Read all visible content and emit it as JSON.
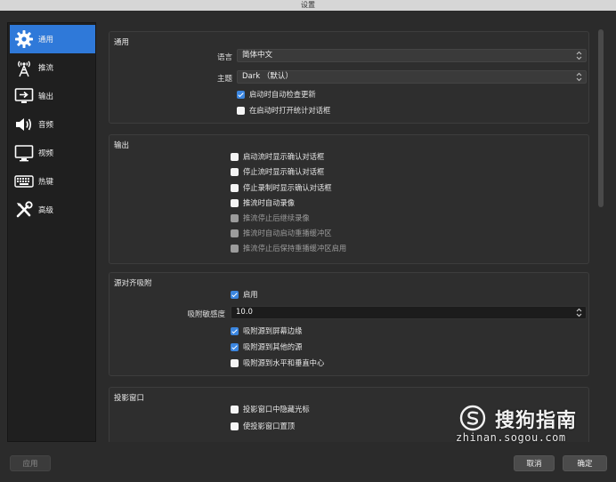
{
  "window": {
    "title": "设置"
  },
  "sidebar": {
    "items": [
      {
        "label": "通用",
        "icon": "gear-icon",
        "active": true
      },
      {
        "label": "推流",
        "icon": "broadcast-tower-icon",
        "active": false
      },
      {
        "label": "输出",
        "icon": "output-monitor-icon",
        "active": false
      },
      {
        "label": "音频",
        "icon": "speaker-icon",
        "active": false
      },
      {
        "label": "视频",
        "icon": "monitor-icon",
        "active": false
      },
      {
        "label": "热键",
        "icon": "keyboard-icon",
        "active": false
      },
      {
        "label": "高级",
        "icon": "tools-icon",
        "active": false
      }
    ]
  },
  "general": {
    "title": "通用",
    "language_label": "语言",
    "language_value": "简体中文",
    "theme_label": "主题",
    "theme_value": "Dark （默认）",
    "checkboxes": [
      {
        "label": "启动时自动检查更新",
        "checked": true,
        "disabled": false
      },
      {
        "label": "在启动时打开统计对话框",
        "checked": false,
        "disabled": false
      }
    ]
  },
  "output": {
    "title": "输出",
    "checkboxes": [
      {
        "label": "启动流时显示确认对话框",
        "checked": false,
        "disabled": false
      },
      {
        "label": "停止流时显示确认对话框",
        "checked": false,
        "disabled": false
      },
      {
        "label": "停止录制时显示确认对话框",
        "checked": false,
        "disabled": false
      },
      {
        "label": "推流时自动录像",
        "checked": false,
        "disabled": false
      },
      {
        "label": "推流停止后继续录像",
        "checked": false,
        "disabled": true
      },
      {
        "label": "推流时自动启动重播缓冲区",
        "checked": false,
        "disabled": true
      },
      {
        "label": "推流停止后保持重播缓冲区启用",
        "checked": false,
        "disabled": true
      }
    ]
  },
  "snapping": {
    "title": "源对齐吸附",
    "enable_label": "启用",
    "enable_checked": true,
    "sensitivity_label": "吸附敏感度",
    "sensitivity_value": "10.0",
    "checkboxes": [
      {
        "label": "吸附源到屏幕边缘",
        "checked": true,
        "disabled": false
      },
      {
        "label": "吸附源到其他的源",
        "checked": true,
        "disabled": false
      },
      {
        "label": "吸附源到水平和垂直中心",
        "checked": false,
        "disabled": false
      }
    ]
  },
  "projector": {
    "title": "投影窗口",
    "checkboxes": [
      {
        "label": "投影窗口中隐藏光标",
        "checked": false,
        "disabled": false
      },
      {
        "label": "使投影窗口置顶",
        "checked": false,
        "disabled": false
      }
    ]
  },
  "footer": {
    "apply_label": "应用",
    "cancel_label": "取消",
    "ok_label": "确定"
  },
  "watermark": {
    "brand": "搜狗指南",
    "url": "zhinan.sogou.com"
  },
  "colors": {
    "accent": "#2f79d9",
    "checkbox_on": "#3b86e0"
  }
}
